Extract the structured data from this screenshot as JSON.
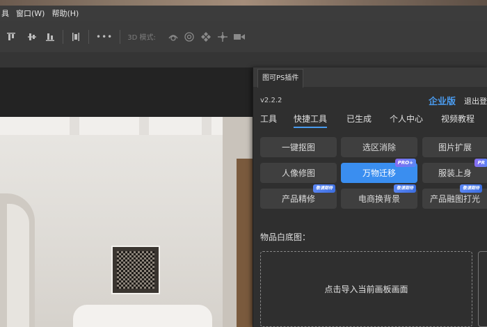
{
  "menubar": {
    "items": [
      "具",
      "窗口(W)",
      "帮助(H)"
    ]
  },
  "optionsbar": {
    "align_icons": [
      "align-top-icon",
      "align-vcenter-icon",
      "align-bottom-icon",
      "distribute-icon"
    ],
    "more": "•••",
    "mode_label": "3D 模式:",
    "mode_icons": [
      "rotate-3d-icon",
      "roll-3d-icon",
      "pan-3d-icon",
      "slide-3d-icon",
      "camera-3d-icon"
    ]
  },
  "panel": {
    "tab_title": "图可PS插件",
    "version": "v2.2.2",
    "enterprise": "企业版",
    "logout": "退出登",
    "nav_tabs": [
      "工具",
      "快捷工具",
      "已生成",
      "个人中心",
      "视频教程"
    ],
    "active_tab": "快捷工具",
    "buttons": [
      {
        "label": "一键抠图",
        "badge": ""
      },
      {
        "label": "选区消除",
        "badge": ""
      },
      {
        "label": "图片扩展",
        "badge": ""
      },
      {
        "label": "人像修图",
        "badge": ""
      },
      {
        "label": "万物迁移",
        "badge": "PRO+"
      },
      {
        "label": "服装上身",
        "badge": "PR"
      },
      {
        "label": "产品精修",
        "badge": "敬请期待"
      },
      {
        "label": "电商换背景",
        "badge": "敬请期待"
      },
      {
        "label": "产品融图打光",
        "badge": "敬请期待"
      }
    ],
    "active_button": "万物迁移",
    "section_label": "物品白底图：",
    "dropzone_text": "点击导入当前画板画面"
  },
  "colors": {
    "accent": "#3a8ef0",
    "enterprise": "#4a9cf0",
    "panel_bg": "#2f2f2f"
  }
}
